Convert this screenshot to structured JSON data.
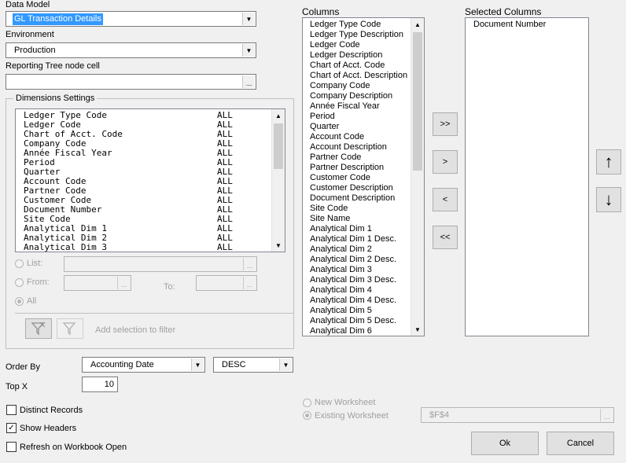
{
  "data_model": {
    "label": "Data Model",
    "value": "GL Transaction Details"
  },
  "environment": {
    "label": "Environment",
    "value": "Production"
  },
  "reporting_tree": {
    "label": "Reporting Tree node cell",
    "value": ""
  },
  "dimensions": {
    "label": "Dimensions Settings",
    "items": [
      {
        "name": "Ledger Type Code",
        "value": "ALL"
      },
      {
        "name": "Ledger Code",
        "value": "ALL"
      },
      {
        "name": "Chart of Acct. Code",
        "value": "ALL"
      },
      {
        "name": "Company Code",
        "value": "ALL"
      },
      {
        "name": "Année Fiscal Year",
        "value": "ALL"
      },
      {
        "name": "Period",
        "value": "ALL"
      },
      {
        "name": "Quarter",
        "value": "ALL"
      },
      {
        "name": "Account Code",
        "value": "ALL"
      },
      {
        "name": "Partner Code",
        "value": "ALL"
      },
      {
        "name": "Customer Code",
        "value": "ALL"
      },
      {
        "name": "Document Number",
        "value": "ALL"
      },
      {
        "name": "Site Code",
        "value": "ALL"
      },
      {
        "name": "Analytical Dim 1",
        "value": "ALL"
      },
      {
        "name": "Analytical Dim 2",
        "value": "ALL"
      },
      {
        "name": "Analytical Dim 3",
        "value": "ALL"
      }
    ],
    "list_label": "List:",
    "from_label": "From:",
    "to_label": "To:",
    "all_label": "All",
    "add_filter_label": "Add selection to filter"
  },
  "columns": {
    "label": "Columns",
    "items": [
      "Ledger Type Code",
      "Ledger Type Description",
      "Ledger Code",
      "Ledger Description",
      "Chart of Acct. Code",
      "Chart of Acct. Description",
      "Company Code",
      "Company Description",
      "Année Fiscal Year",
      "Period",
      "Quarter",
      "Account Code",
      "Account Description",
      "Partner Code",
      "Partner Description",
      "Customer Code",
      "Customer Description",
      "Document Description",
      "Site Code",
      "Site Name",
      "Analytical Dim 1",
      "Analytical Dim 1 Desc.",
      "Analytical Dim 2",
      "Analytical Dim 2 Desc.",
      "Analytical Dim 3",
      "Analytical Dim 3 Desc.",
      "Analytical Dim 4",
      "Analytical Dim 4 Desc.",
      "Analytical Dim 5",
      "Analytical Dim 5 Desc.",
      "Analytical Dim 6"
    ]
  },
  "selected_columns": {
    "label": "Selected Columns",
    "items": [
      "Document Number"
    ]
  },
  "transfer_buttons": {
    "add_all": ">>",
    "add": ">",
    "remove": "<",
    "remove_all": "<<"
  },
  "move_buttons": {
    "up": "↑",
    "down": "↓"
  },
  "order_by": {
    "label": "Order By",
    "field": "Accounting Date",
    "direction": "DESC"
  },
  "top_x": {
    "label": "Top X",
    "value": "10"
  },
  "options": {
    "distinct": {
      "label": "Distinct Records",
      "checked": false
    },
    "headers": {
      "label": "Show Headers",
      "checked": true,
      "mark": "✓"
    },
    "refresh": {
      "label": "Refresh on Workbook Open",
      "checked": false
    }
  },
  "output": {
    "new_worksheet": "New Worksheet",
    "existing_worksheet": "Existing Worksheet",
    "cell": "$F$4"
  },
  "ok_label": "Ok",
  "cancel_label": "Cancel",
  "icons": {
    "dropdown": "▼",
    "scroll_up": "▲",
    "scroll_down": "▼",
    "ellipsis": "..."
  }
}
